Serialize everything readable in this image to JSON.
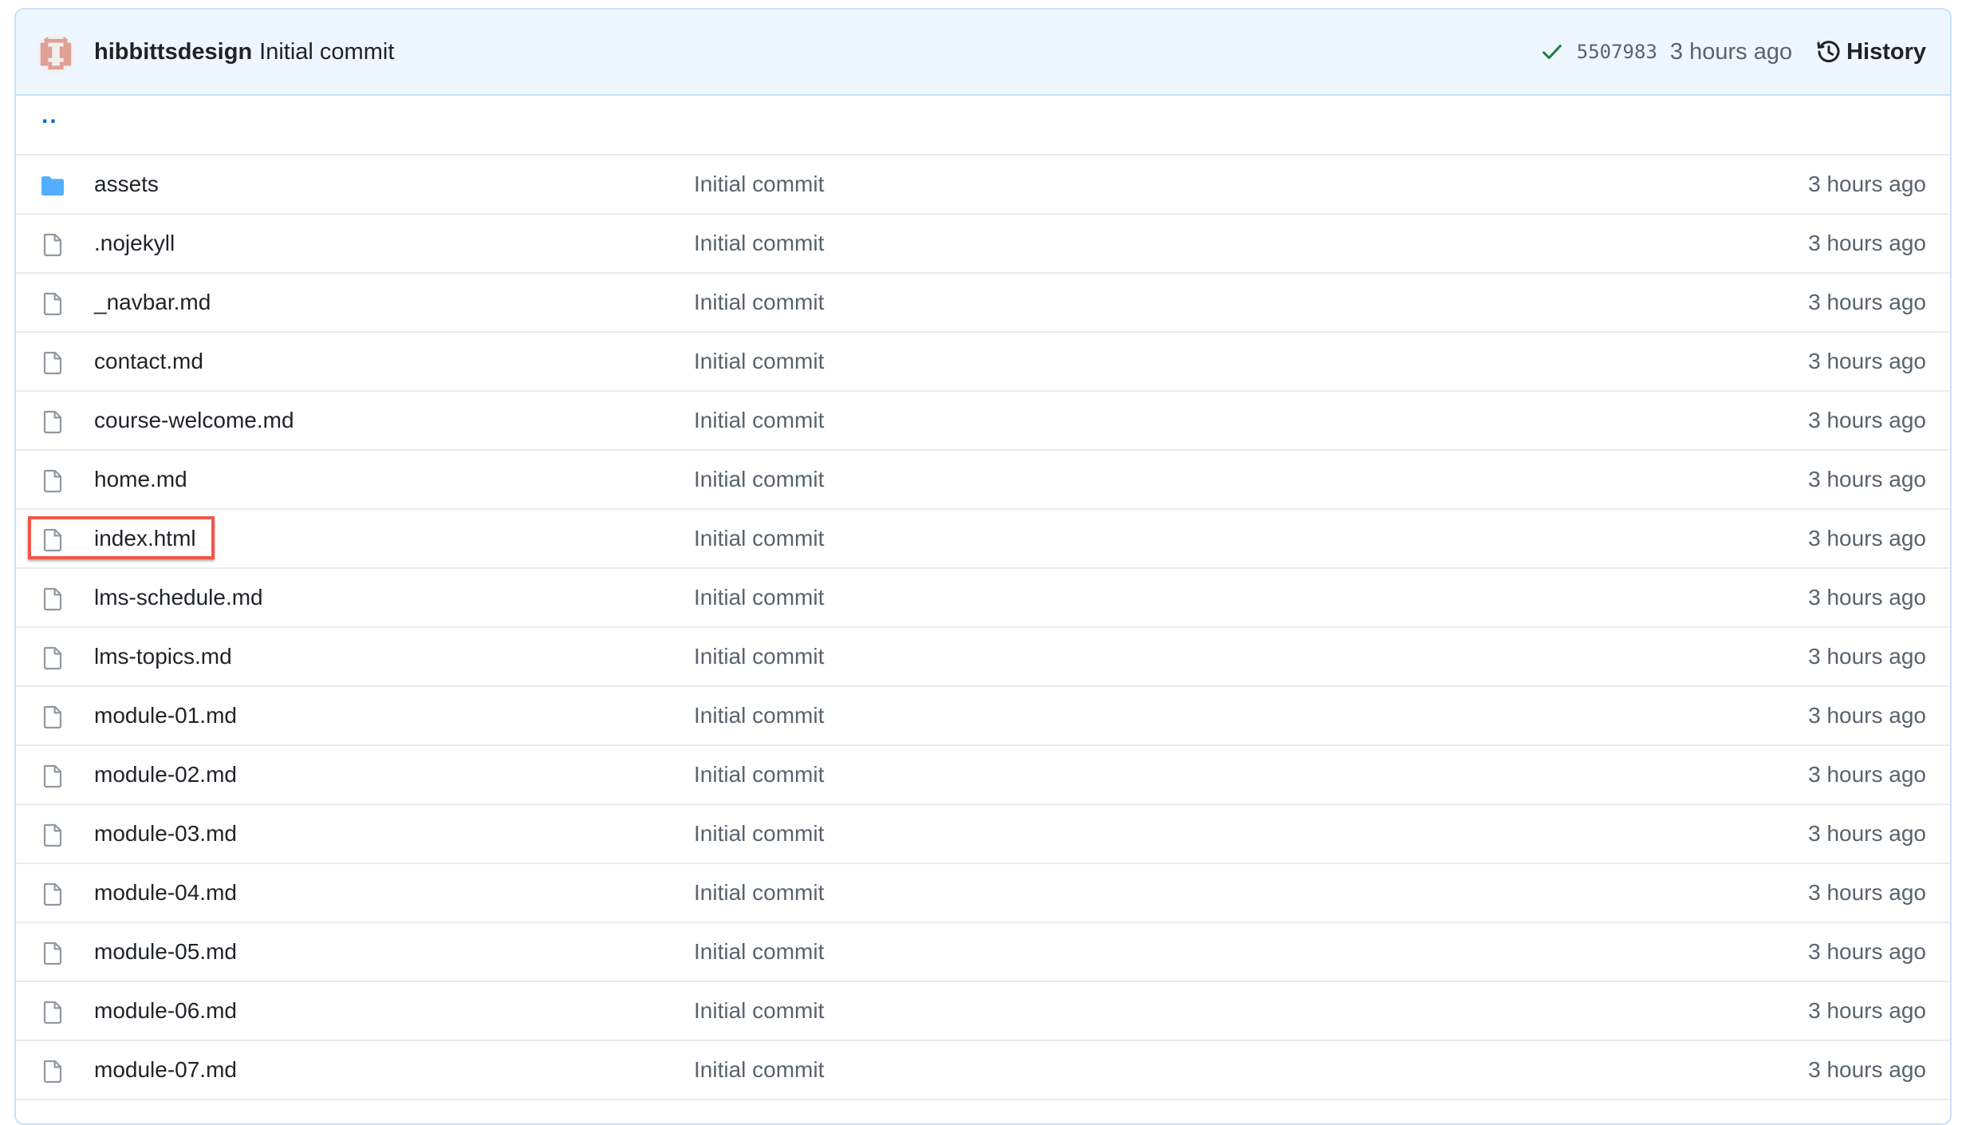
{
  "header": {
    "author": "hibbittsdesign",
    "commit_message": "Initial commit",
    "status_icon": "check-icon",
    "status_color": "#1a7f37",
    "sha": "5507983",
    "time_ago": "3 hours ago",
    "history_label": "History",
    "history_icon": "history-icon"
  },
  "parent_dir": {
    "label": ".."
  },
  "colors": {
    "folder": "#54aeff",
    "file_icon": "#9198a1",
    "link": "#0969da",
    "highlight": "#f0574a",
    "header_bg": "#eef6ff"
  },
  "files": [
    {
      "name": "assets",
      "type": "folder",
      "icon": "folder-icon",
      "commit": "Initial commit",
      "time": "3 hours ago"
    },
    {
      "name": ".nojekyll",
      "type": "file",
      "icon": "file-icon",
      "commit": "Initial commit",
      "time": "3 hours ago"
    },
    {
      "name": "_navbar.md",
      "type": "file",
      "icon": "file-icon",
      "commit": "Initial commit",
      "time": "3 hours ago"
    },
    {
      "name": "contact.md",
      "type": "file",
      "icon": "file-icon",
      "commit": "Initial commit",
      "time": "3 hours ago"
    },
    {
      "name": "course-welcome.md",
      "type": "file",
      "icon": "file-icon",
      "commit": "Initial commit",
      "time": "3 hours ago"
    },
    {
      "name": "home.md",
      "type": "file",
      "icon": "file-icon",
      "commit": "Initial commit",
      "time": "3 hours ago"
    },
    {
      "name": "index.html",
      "type": "file",
      "icon": "file-icon",
      "commit": "Initial commit",
      "time": "3 hours ago",
      "highlighted": true
    },
    {
      "name": "lms-schedule.md",
      "type": "file",
      "icon": "file-icon",
      "commit": "Initial commit",
      "time": "3 hours ago"
    },
    {
      "name": "lms-topics.md",
      "type": "file",
      "icon": "file-icon",
      "commit": "Initial commit",
      "time": "3 hours ago"
    },
    {
      "name": "module-01.md",
      "type": "file",
      "icon": "file-icon",
      "commit": "Initial commit",
      "time": "3 hours ago"
    },
    {
      "name": "module-02.md",
      "type": "file",
      "icon": "file-icon",
      "commit": "Initial commit",
      "time": "3 hours ago"
    },
    {
      "name": "module-03.md",
      "type": "file",
      "icon": "file-icon",
      "commit": "Initial commit",
      "time": "3 hours ago"
    },
    {
      "name": "module-04.md",
      "type": "file",
      "icon": "file-icon",
      "commit": "Initial commit",
      "time": "3 hours ago"
    },
    {
      "name": "module-05.md",
      "type": "file",
      "icon": "file-icon",
      "commit": "Initial commit",
      "time": "3 hours ago"
    },
    {
      "name": "module-06.md",
      "type": "file",
      "icon": "file-icon",
      "commit": "Initial commit",
      "time": "3 hours ago"
    },
    {
      "name": "module-07.md",
      "type": "file",
      "icon": "file-icon",
      "commit": "Initial commit",
      "time": "3 hours ago"
    }
  ]
}
